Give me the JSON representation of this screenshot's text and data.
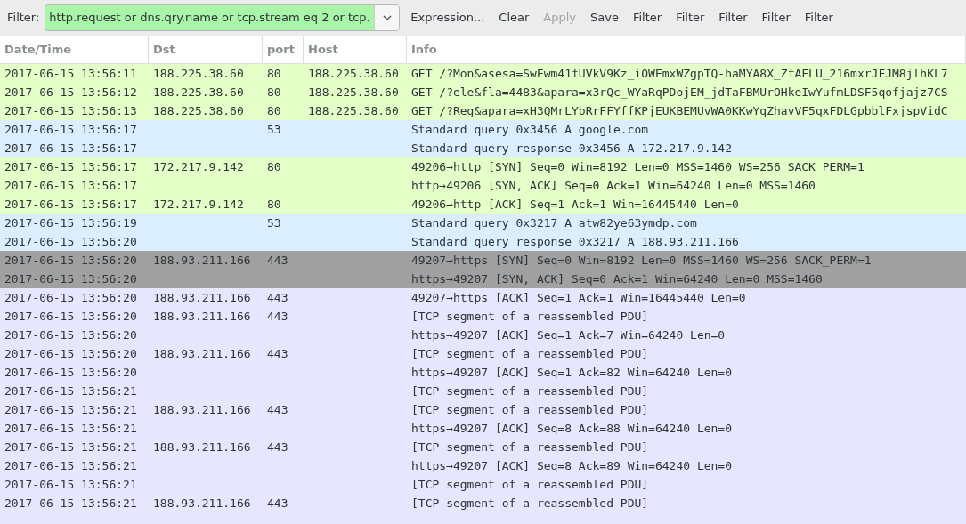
{
  "toolbar": {
    "label": "Filter:",
    "filter": {
      "value": "http.request or dns.qry.name or tcp.stream eq 2 or tcp."
    },
    "buttons": [
      {
        "label": "Expression...",
        "disabled": false
      },
      {
        "label": "Clear",
        "disabled": false
      },
      {
        "label": "Apply",
        "disabled": true
      },
      {
        "label": "Save",
        "disabled": false
      },
      {
        "label": "Filter",
        "disabled": false
      },
      {
        "label": "Filter",
        "disabled": false
      },
      {
        "label": "Filter",
        "disabled": false
      },
      {
        "label": "Filter",
        "disabled": false
      },
      {
        "label": "Filter",
        "disabled": false
      }
    ]
  },
  "table": {
    "columns": [
      "Date/Time",
      "Dst",
      "port",
      "Host",
      "Info"
    ],
    "rows": [
      {
        "time": "2017-06-15 13:56:11",
        "dst": "188.225.38.60",
        "port": "80",
        "host": "188.225.38.60",
        "info": "GET /?Mon&asesa=SwEwm41fUVkV9Kz_iOWEmxWZgpTQ-haMYA8X_ZfAFLU_216mxrJFJM8jlhKL7",
        "color": "#e4ffc7"
      },
      {
        "time": "2017-06-15 13:56:12",
        "dst": "188.225.38.60",
        "port": "80",
        "host": "188.225.38.60",
        "info": "GET /?ele&fla=4483&apara=x3rQc_WYaRqPDojEM_jdTaFBMUrOHkeIwYufmLDSF5qofjajz7CS",
        "color": "#e4ffc7"
      },
      {
        "time": "2017-06-15 13:56:13",
        "dst": "188.225.38.60",
        "port": "80",
        "host": "188.225.38.60",
        "info": "GET /?Reg&apara=xH3QMrLYbRrFFYffKPjEUKBEMUvWA0KKwYqZhavVF5qxFDLGpbblFxjspVidC",
        "color": "#e4ffc7"
      },
      {
        "time": "2017-06-15 13:56:17",
        "port": "53",
        "info": "Standard query 0x3456  A google.com",
        "color": "#daeeff"
      },
      {
        "time": "2017-06-15 13:56:17",
        "info": "Standard query response 0x3456  A 172.217.9.142",
        "color": "#daeeff"
      },
      {
        "time": "2017-06-15 13:56:17",
        "dst": "172.217.9.142",
        "port": "80",
        "info": "49206→http [SYN] Seq=0 Win=8192 Len=0 MSS=1460 WS=256 SACK_PERM=1",
        "color": "#e4ffc7"
      },
      {
        "time": "2017-06-15 13:56:17",
        "info": "http→49206 [SYN, ACK] Seq=0 Ack=1 Win=64240 Len=0 MSS=1460",
        "color": "#e4ffc7"
      },
      {
        "time": "2017-06-15 13:56:17",
        "dst": "172.217.9.142",
        "port": "80",
        "info": "49206→http [ACK] Seq=1 Ack=1 Win=16445440 Len=0",
        "color": "#e4ffc7"
      },
      {
        "time": "2017-06-15 13:56:19",
        "port": "53",
        "info": "Standard query 0x3217  A atw82ye63ymdp.com",
        "color": "#daeeff"
      },
      {
        "time": "2017-06-15 13:56:20",
        "info": "Standard query response 0x3217  A 188.93.211.166",
        "color": "#daeeff"
      },
      {
        "time": "2017-06-15 13:56:20",
        "dst": "188.93.211.166",
        "port": "443",
        "info": "49207→https [SYN] Seq=0 Win=8192 Len=0 MSS=1460 WS=256 SACK_PERM=1",
        "color": "#a0a0a0"
      },
      {
        "time": "2017-06-15 13:56:20",
        "info": "https→49207 [SYN, ACK] Seq=0 Ack=1 Win=64240 Len=0 MSS=1460",
        "color": "#a0a0a0"
      },
      {
        "time": "2017-06-15 13:56:20",
        "dst": "188.93.211.166",
        "port": "443",
        "info": "49207→https [ACK] Seq=1 Ack=1 Win=16445440 Len=0",
        "color": "#e7e6ff"
      },
      {
        "time": "2017-06-15 13:56:20",
        "dst": "188.93.211.166",
        "port": "443",
        "info": "[TCP segment of a reassembled PDU]",
        "color": "#e7e6ff"
      },
      {
        "time": "2017-06-15 13:56:20",
        "info": "https→49207 [ACK] Seq=1 Ack=7 Win=64240 Len=0",
        "color": "#e7e6ff"
      },
      {
        "time": "2017-06-15 13:56:20",
        "dst": "188.93.211.166",
        "port": "443",
        "info": "[TCP segment of a reassembled PDU]",
        "color": "#e7e6ff"
      },
      {
        "time": "2017-06-15 13:56:20",
        "info": "https→49207 [ACK] Seq=1 Ack=82 Win=64240 Len=0",
        "color": "#e7e6ff"
      },
      {
        "time": "2017-06-15 13:56:21",
        "info": "[TCP segment of a reassembled PDU]",
        "color": "#e7e6ff"
      },
      {
        "time": "2017-06-15 13:56:21",
        "dst": "188.93.211.166",
        "port": "443",
        "info": "[TCP segment of a reassembled PDU]",
        "color": "#e7e6ff"
      },
      {
        "time": "2017-06-15 13:56:21",
        "info": "https→49207 [ACK] Seq=8 Ack=88 Win=64240 Len=0",
        "color": "#e7e6ff"
      },
      {
        "time": "2017-06-15 13:56:21",
        "dst": "188.93.211.166",
        "port": "443",
        "info": "[TCP segment of a reassembled PDU]",
        "color": "#e7e6ff"
      },
      {
        "time": "2017-06-15 13:56:21",
        "info": "https→49207 [ACK] Seq=8 Ack=89 Win=64240 Len=0",
        "color": "#e7e6ff"
      },
      {
        "time": "2017-06-15 13:56:21",
        "info": "[TCP segment of a reassembled PDU]",
        "color": "#e7e6ff"
      },
      {
        "time": "2017-06-15 13:56:21",
        "dst": "188.93.211.166",
        "port": "443",
        "info": "[TCP segment of a reassembled PDU]",
        "color": "#e7e6ff"
      }
    ]
  }
}
